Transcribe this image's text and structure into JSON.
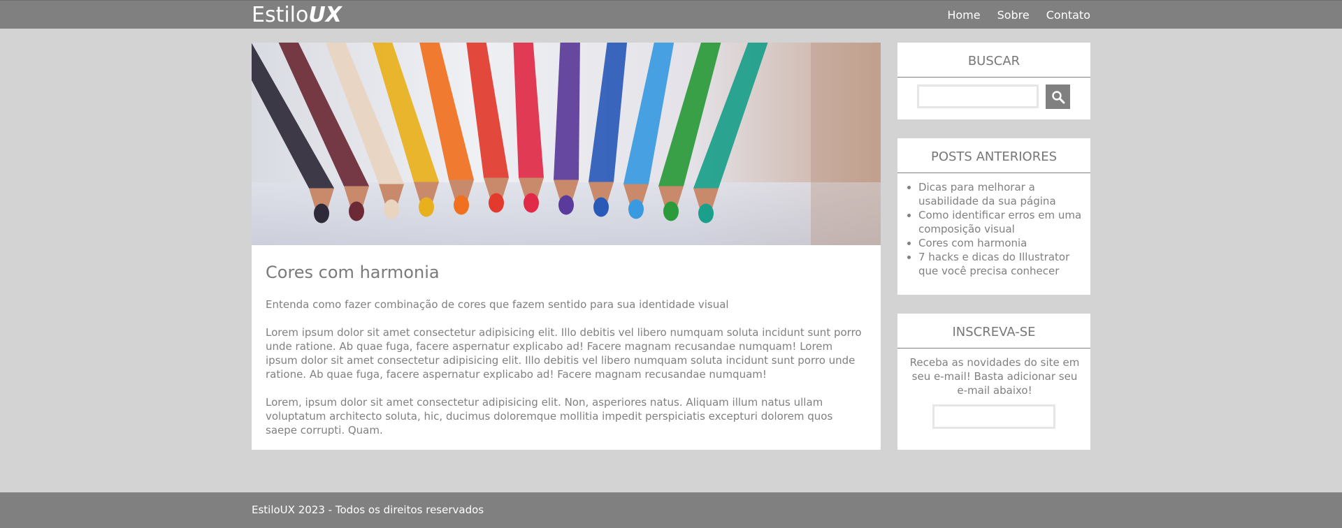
{
  "header": {
    "logo_light": "Estilo",
    "logo_bold": "UX",
    "nav": [
      "Home",
      "Sobre",
      "Contato"
    ]
  },
  "post": {
    "hero_image": "colored-pencils-image",
    "title": "Cores com harmonia",
    "subtitle": "Entenda como fazer combinação de cores que fazem sentido para sua identidade visual",
    "paragraphs": [
      "Lorem ipsum dolor sit amet consectetur adipisicing elit. Illo debitis vel libero numquam soluta incidunt sunt porro unde ratione. Ab quae fuga, facere aspernatur explicabo ad! Facere magnam recusandae numquam! Lorem ipsum dolor sit amet consectetur adipisicing elit. Illo debitis vel libero numquam soluta incidunt sunt porro unde ratione. Ab quae fuga, facere aspernatur explicabo ad! Facere magnam recusandae numquam!",
      "Lorem, ipsum dolor sit amet consectetur adipisicing elit. Non, asperiores natus. Aliquam illum natus ullam voluptatum architecto soluta, hic, ducimus doloremque mollitia impedit perspiciatis excepturi dolorem quos saepe corrupti. Quam."
    ]
  },
  "sidebar": {
    "buscar": {
      "title": "BUSCAR",
      "button_icon": "search-icon",
      "value": ""
    },
    "posts": {
      "title": "POSTS ANTERIORES",
      "items": [
        "Dicas para melhorar a usabilidade da sua página",
        "Como identificar erros em uma composição visual",
        "Cores com harmonia",
        "7 hacks e dicas do Illustrator que você precisa conhecer"
      ]
    },
    "inscreva": {
      "title": "INSCREVA-SE",
      "text": "Receba as novidades do site em seu e-mail! Basta adicionar seu e-mail abaixo!",
      "value": ""
    }
  },
  "footer": {
    "text": "EstiloUX 2023 - Todos os direitos reservados"
  },
  "colors": {
    "header_bg": "#808080",
    "page_bg": "#d3d3d3",
    "card_bg": "#ffffff",
    "text": "#808080"
  }
}
